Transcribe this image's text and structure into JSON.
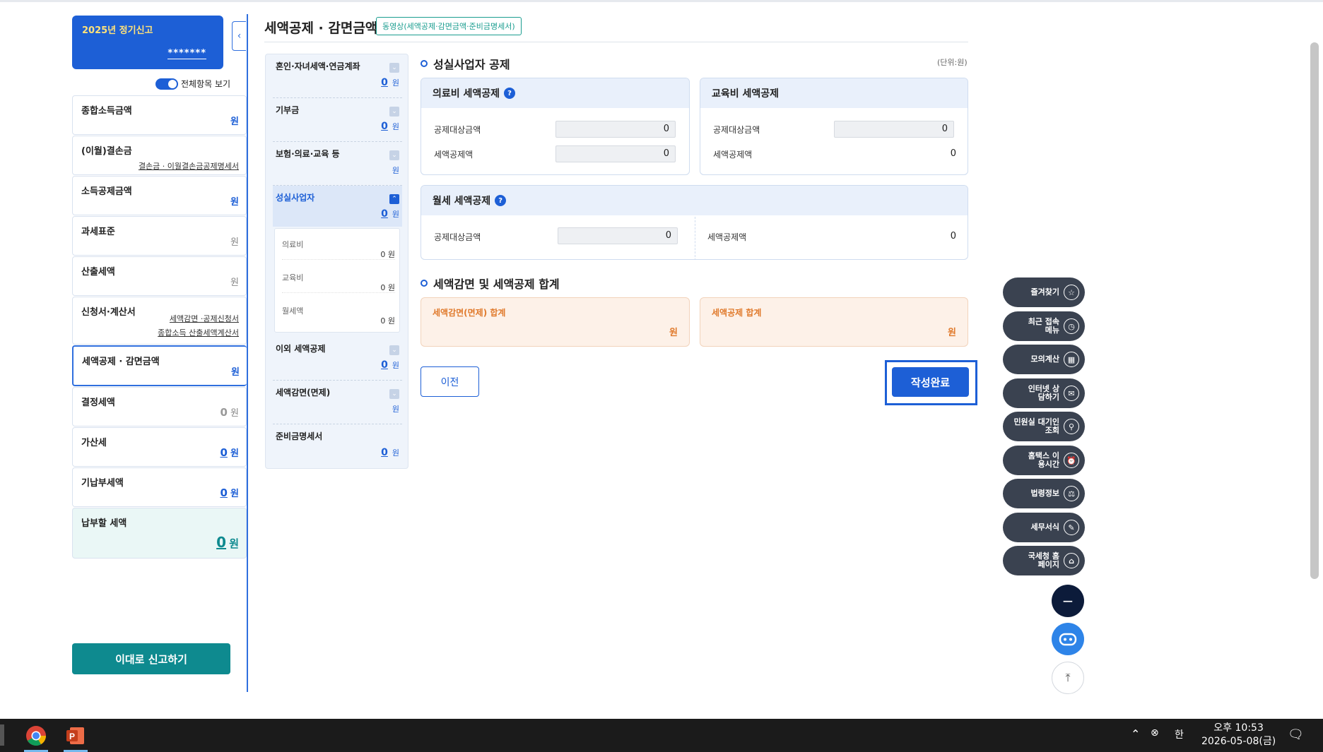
{
  "left": {
    "profile_title": "2025년 정기신고",
    "profile_id": "*******",
    "toggle_label": "전체항목 보기",
    "items": [
      {
        "label": "종합소득금액",
        "value": "원"
      },
      {
        "label": "(이월)결손금",
        "link": "결손금 · 이월결손금공제명세서"
      },
      {
        "label": "소득공제금액",
        "value": "원"
      },
      {
        "label": "과세표준",
        "value": "원"
      },
      {
        "label": "산출세액",
        "value": "원"
      },
      {
        "label": "신청서·계산서",
        "link1": "세액감면 ·공제신청서",
        "link2": "종합소득 산출세액계산서"
      },
      {
        "label": "세액공제 · 감면금액",
        "value": "원"
      },
      {
        "label": "결정세액",
        "amount": "0",
        "unit": "원"
      },
      {
        "label": "가산세",
        "amount": "0",
        "unit": "원"
      },
      {
        "label": "기납부세액",
        "amount": "0",
        "unit": "원"
      },
      {
        "label": "납부할 세액",
        "amount": "0",
        "unit": "원"
      }
    ],
    "report_button": "이대로 신고하기"
  },
  "header": {
    "title": "세액공제 · 감면금액",
    "video_link": "동영상(세액공제·감면금액·준비금명세서)"
  },
  "categories": [
    {
      "name": "혼인·자녀세액·연금계좌",
      "amount": "0",
      "unit": "원"
    },
    {
      "name": "기부금",
      "amount": "0",
      "unit": "원"
    },
    {
      "name": "보험·의료·교육 등",
      "amount": "",
      "unit": "원"
    },
    {
      "name": "성실사업자",
      "amount": "0",
      "unit": "원"
    },
    {
      "name": "이외 세액공제",
      "amount": "0",
      "unit": "원"
    },
    {
      "name": "세액감면(면제)",
      "amount": "",
      "unit": "원"
    },
    {
      "name": "준비금명세서",
      "amount": "0",
      "unit": "원"
    }
  ],
  "subcategories": [
    {
      "name": "의료비",
      "value": "0 원"
    },
    {
      "name": "교육비",
      "value": "0 원"
    },
    {
      "name": "월세액",
      "value": "0 원"
    }
  ],
  "section1": {
    "title": "성실사업자 공제",
    "unit": "(단위:원)",
    "medical": {
      "title": "의료비 세액공제",
      "target_label": "공제대상금액",
      "target_value": "0",
      "credit_label": "세액공제액",
      "credit_value": "0"
    },
    "education": {
      "title": "교육비 세액공제",
      "target_label": "공제대상금액",
      "target_value": "0",
      "credit_label": "세액공제액",
      "credit_value": "0"
    },
    "rent": {
      "title": "월세 세액공제",
      "target_label": "공제대상금액",
      "target_value": "0",
      "credit_label": "세액공제액",
      "credit_value": "0"
    }
  },
  "section2": {
    "title": "세액감면 및 세액공제 합계",
    "reduction_total": {
      "label": "세액감면(면제) 합계",
      "unit": "원"
    },
    "credit_total": {
      "label": "세액공제 합계",
      "unit": "원"
    }
  },
  "buttons": {
    "prev": "이전",
    "done": "작성완료"
  },
  "quick_menu": [
    {
      "label": "즐겨찾기",
      "icon": "star-icon",
      "glyph": "☆"
    },
    {
      "label": "최근 접속메뉴",
      "icon": "clock-icon",
      "glyph": "◷"
    },
    {
      "label": "모의계산",
      "icon": "calculator-icon",
      "glyph": "▦"
    },
    {
      "label": "인터넷 상담하기",
      "icon": "chat-icon",
      "glyph": "✉"
    },
    {
      "label": "민원실 대기인 조회",
      "icon": "person-search-icon",
      "glyph": "⚲"
    },
    {
      "label": "홈택스 이용시간",
      "icon": "alarm-icon",
      "glyph": "⏰"
    },
    {
      "label": "법령정보",
      "icon": "gavel-icon",
      "glyph": "⚖"
    },
    {
      "label": "세무서식",
      "icon": "document-icon",
      "glyph": "✎"
    },
    {
      "label": "국세청 홈페이지",
      "icon": "building-icon",
      "glyph": "⌂"
    }
  ],
  "taskbar": {
    "time": "오후 10:53",
    "date": "2026-05-08(금)",
    "ime": "한"
  }
}
